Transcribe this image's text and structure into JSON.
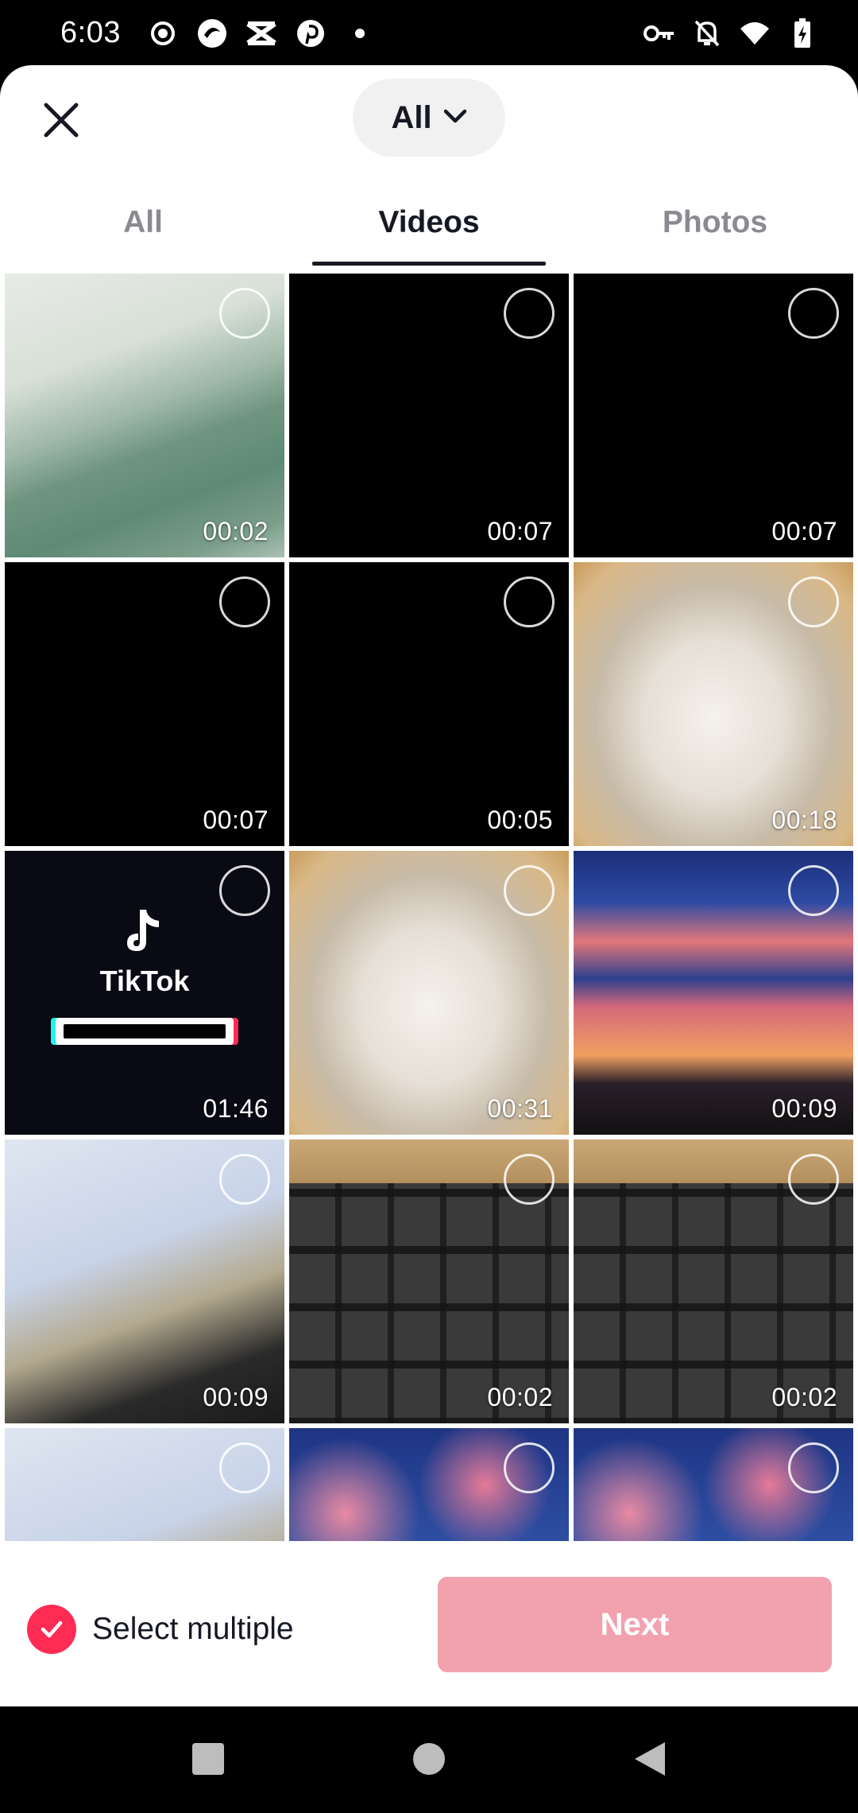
{
  "status_bar": {
    "time": "6:03",
    "left_icons": [
      "record-icon",
      "app-icon",
      "capcut-icon",
      "pinterest-icon",
      "dot-icon"
    ],
    "right_icons": [
      "vpn-key-icon",
      "bell-off-icon",
      "wifi-icon",
      "battery-charging-icon"
    ]
  },
  "header": {
    "close_icon": "close-icon",
    "album_label": "All",
    "album_icon": "chevron-down-icon"
  },
  "tabs": [
    {
      "label": "All",
      "active": false
    },
    {
      "label": "Videos",
      "active": true
    },
    {
      "label": "Photos",
      "active": false
    }
  ],
  "grid": {
    "items": [
      {
        "duration": "00:02",
        "thumb": "green"
      },
      {
        "duration": "00:07",
        "thumb": "black"
      },
      {
        "duration": "00:07",
        "thumb": "black"
      },
      {
        "duration": "00:07",
        "thumb": "black"
      },
      {
        "duration": "00:05",
        "thumb": "black"
      },
      {
        "duration": "00:18",
        "thumb": "cat"
      },
      {
        "duration": "01:46",
        "thumb": "tiktok"
      },
      {
        "duration": "00:31",
        "thumb": "cat"
      },
      {
        "duration": "00:09",
        "thumb": "sunset"
      },
      {
        "duration": "00:09",
        "thumb": "tissue"
      },
      {
        "duration": "00:02",
        "thumb": "keyboard"
      },
      {
        "duration": "00:02",
        "thumb": "keyboard"
      },
      {
        "duration": "",
        "thumb": "tissue"
      },
      {
        "duration": "",
        "thumb": "clouds"
      },
      {
        "duration": "",
        "thumb": "clouds"
      }
    ],
    "tiktok_word": "TikTok"
  },
  "bottom": {
    "select_multiple_label": "Select multiple",
    "next_label": "Next"
  },
  "colors": {
    "accent": "#fe2c55",
    "next_disabled": "#f2a1ae",
    "text_primary": "#161823",
    "text_secondary": "#8a8b91"
  }
}
